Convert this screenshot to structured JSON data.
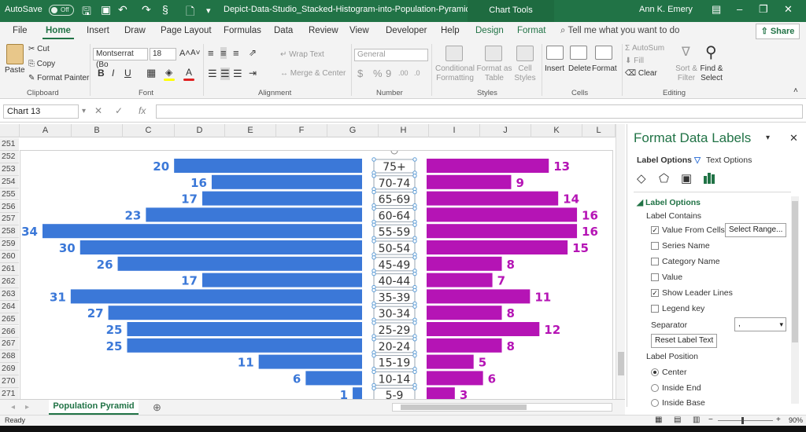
{
  "titlebar": {
    "autosave": "AutoSave",
    "autosave_state": "Off",
    "filename": "Depict-Data-Studio_Stacked-Histogram-into-Population-Pyramid -...",
    "context": "Chart Tools",
    "user": "Ann K. Emery"
  },
  "tabs": [
    "File",
    "Home",
    "Insert",
    "Draw",
    "Page Layout",
    "Formulas",
    "Data",
    "Review",
    "View",
    "Developer",
    "Help",
    "Design",
    "Format"
  ],
  "tellme": "Tell me what you want to do",
  "share": "Share",
  "ribbon": {
    "paste": "Paste",
    "cut": "Cut",
    "copy": "Copy",
    "format_painter": "Format Painter",
    "clipboard": "Clipboard",
    "font_name": "Montserrat (Bo",
    "font_size": "18",
    "font": "Font",
    "wrap_text": "Wrap Text",
    "merge_center": "Merge & Center",
    "alignment": "Alignment",
    "number_format": "General",
    "number": "Number",
    "conditional_formatting": "Conditional Formatting",
    "format_as_table": "Format as Table",
    "cell_styles": "Cell Styles",
    "styles": "Styles",
    "insert": "Insert",
    "delete": "Delete",
    "format": "Format",
    "cells": "Cells",
    "autosum": "AutoSum",
    "fill": "Fill",
    "clear": "Clear",
    "sort_filter": "Sort & Filter",
    "find_select": "Find & Select",
    "editing": "Editing"
  },
  "formula_bar": {
    "name_box": "Chart 13",
    "fx": "fx"
  },
  "columns": [
    "A",
    "B",
    "C",
    "D",
    "E",
    "F",
    "G",
    "H",
    "I",
    "J",
    "K",
    "L"
  ],
  "rows": [
    "251",
    "252",
    "253",
    "254",
    "255",
    "256",
    "257",
    "258",
    "259",
    "260",
    "261",
    "262",
    "263",
    "264",
    "265",
    "266",
    "267",
    "268",
    "269",
    "270",
    "271"
  ],
  "colors": {
    "left": "#3b78d8",
    "right": "#b514b5",
    "excel_green": "#217346"
  },
  "chart_data": {
    "type": "bar",
    "categories": [
      "75+",
      "70-74",
      "65-69",
      "60-64",
      "55-59",
      "50-54",
      "45-49",
      "40-44",
      "35-39",
      "30-34",
      "25-29",
      "20-24",
      "15-19",
      "10-14",
      "5-9"
    ],
    "series": [
      {
        "values": [
          20,
          16,
          17,
          23,
          34,
          30,
          26,
          17,
          31,
          27,
          25,
          25,
          11,
          6,
          1
        ]
      },
      {
        "values": [
          13,
          9,
          14,
          16,
          16,
          15,
          8,
          7,
          11,
          8,
          12,
          8,
          5,
          6,
          3
        ]
      }
    ],
    "orientation": "horizontal-diverging",
    "xlim": [
      0,
      34
    ],
    "grid": false,
    "legend": "none"
  },
  "pane": {
    "title": "Format Data Labels",
    "tab_label_options": "Label Options",
    "tab_text_options": "Text Options",
    "section": "Label Options",
    "label_contains": "Label Contains",
    "value_from_cells": "Value From Cells",
    "select_range": "Select Range...",
    "series_name": "Series Name",
    "category_name": "Category Name",
    "value": "Value",
    "show_leader_lines": "Show Leader Lines",
    "legend_key": "Legend key",
    "separator": "Separator",
    "separator_value": ",",
    "reset_label_text": "Reset Label Text",
    "label_position": "Label Position",
    "center": "Center",
    "inside_end": "Inside End",
    "inside_base": "Inside Base"
  },
  "sheet_tab": "Population Pyramid",
  "status": {
    "ready": "Ready",
    "zoom": "90%"
  }
}
